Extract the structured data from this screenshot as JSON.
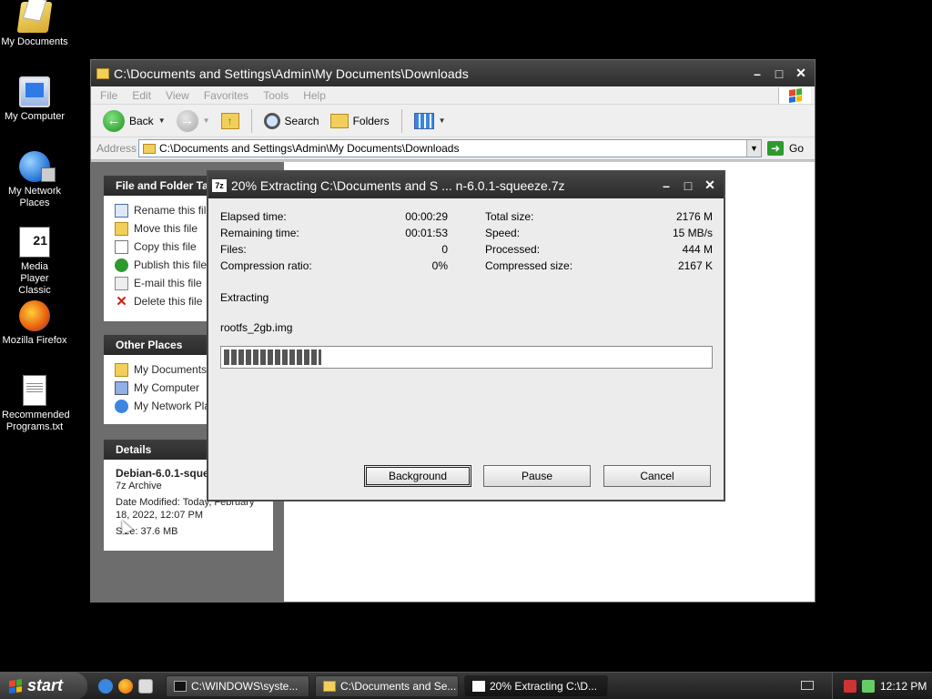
{
  "desktop": {
    "icons": [
      {
        "label": "My Documents"
      },
      {
        "label": "My Computer"
      },
      {
        "label": "My Network Places"
      },
      {
        "label": "Media Player Classic"
      },
      {
        "label": "Mozilla Firefox"
      },
      {
        "label": "Recommended Programs.txt"
      }
    ]
  },
  "explorer": {
    "title": "C:\\Documents and Settings\\Admin\\My Documents\\Downloads",
    "menu": [
      "File",
      "Edit",
      "View",
      "Favorites",
      "Tools",
      "Help"
    ],
    "toolbar": {
      "back": "Back",
      "search": "Search",
      "folders": "Folders"
    },
    "address": {
      "label": "Address",
      "value": "C:\\Documents and Settings\\Admin\\My Documents\\Downloads",
      "go": "Go"
    },
    "tasks_panel": {
      "title": "File and Folder Ta",
      "items": [
        "Rename this file",
        "Move this file",
        "Copy this file",
        "Publish this file t",
        "E-mail this file",
        "Delete this file"
      ]
    },
    "other_places": {
      "title": "Other Places",
      "items": [
        "My Documents",
        "My Computer",
        "My Network Plac"
      ]
    },
    "details": {
      "title": "Details",
      "name": "Debian-6.0.1-sque",
      "type": "7z Archive",
      "modified_line1": "Date Modified: Today, February",
      "modified_line2": "18, 2022, 12:07 PM",
      "size": "Size: 37.6 MB"
    }
  },
  "dialog": {
    "title": "20% Extracting C:\\Documents and S ... n-6.0.1-squeeze.7z",
    "progress": 0.2,
    "stats": [
      {
        "label": "Elapsed time:",
        "value": "00:00:29",
        "label2": "Total size:",
        "value2": "2176 M"
      },
      {
        "label": "Remaining time:",
        "value": "00:01:53",
        "label2": "Speed:",
        "value2": "15 MB/s"
      },
      {
        "label": "Files:",
        "value": "0",
        "label2": "Processed:",
        "value2": "444 M"
      },
      {
        "label": "Compression ratio:",
        "value": "0%",
        "label2": "Compressed size:",
        "value2": "2167 K"
      }
    ],
    "operation": "Extracting",
    "current_file": "rootfs_2gb.img",
    "buttons": {
      "background": "Background",
      "pause": "Pause",
      "cancel": "Cancel"
    }
  },
  "taskbar": {
    "start": "start",
    "tasks": [
      "C:\\WINDOWS\\syste...",
      "C:\\Documents and Se...",
      "20% Extracting C:\\D..."
    ],
    "clock": "12:12 PM"
  }
}
